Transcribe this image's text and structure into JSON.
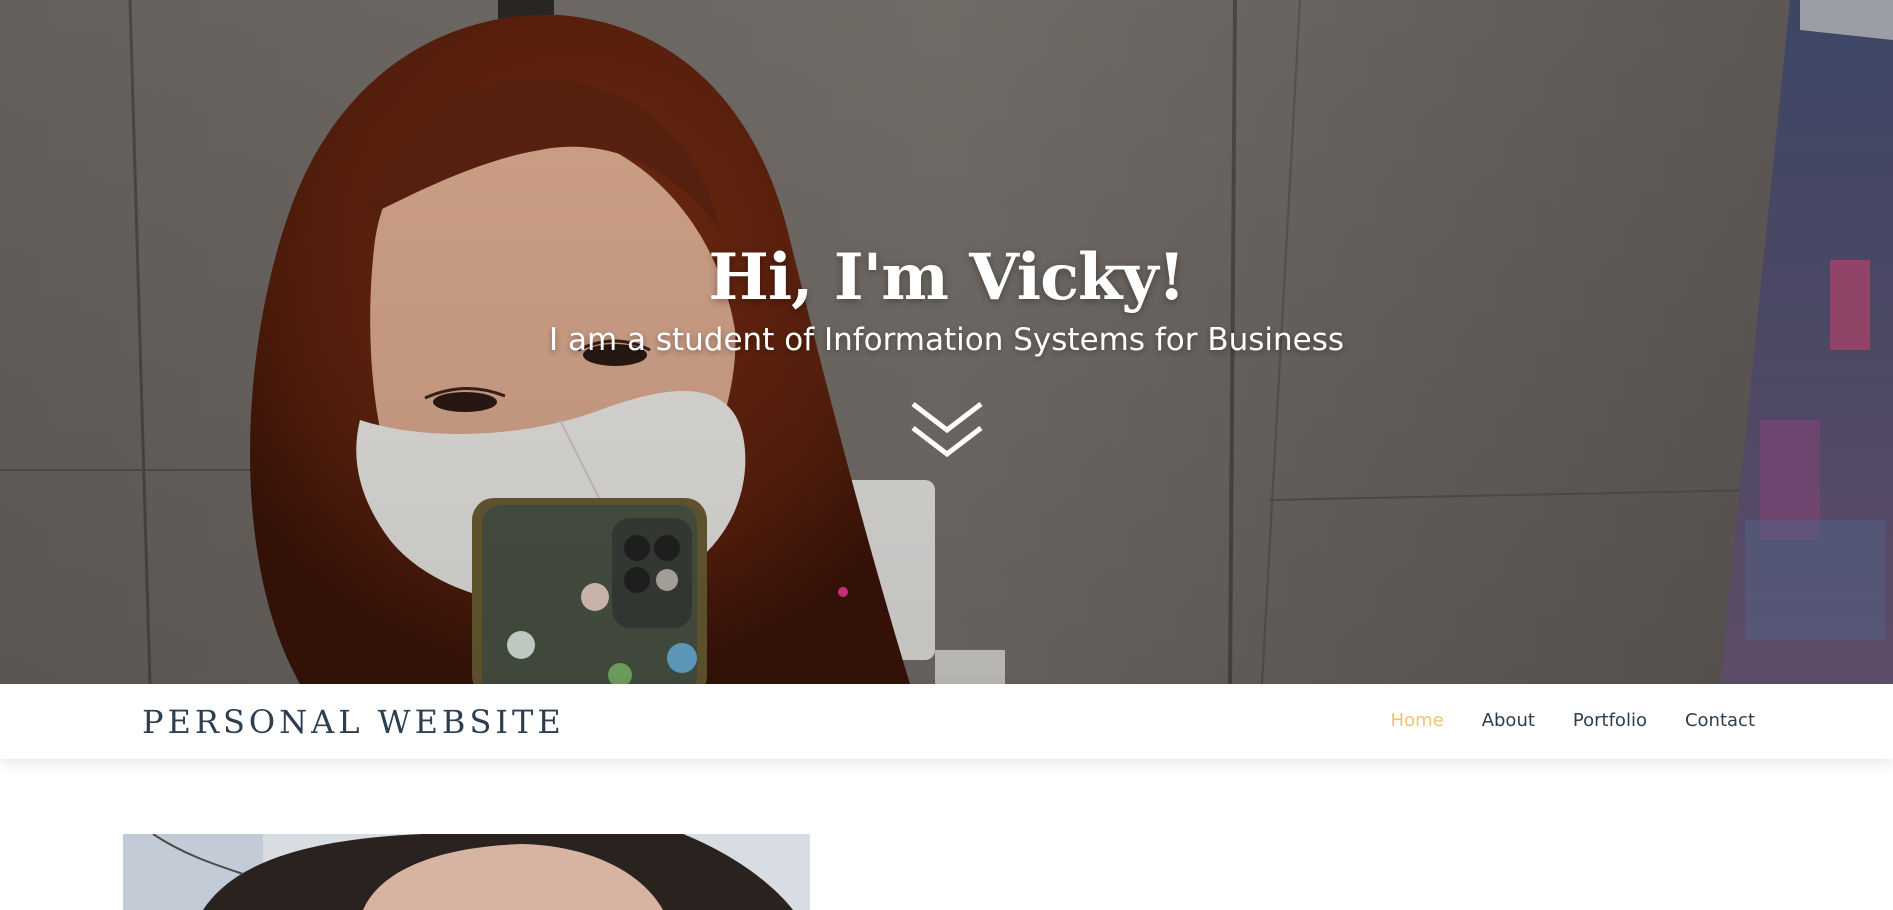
{
  "hero": {
    "title": "Hi, I'm Vicky!",
    "subtitle": "I am a student of Information Systems for Business",
    "scroll_icon": "double-chevron-down-icon",
    "photo": "hero-selfie-photo"
  },
  "navbar": {
    "brand": "PERSONAL WEBSITE",
    "links": [
      {
        "label": "Home",
        "active": true
      },
      {
        "label": "About",
        "active": false
      },
      {
        "label": "Portfolio",
        "active": false
      },
      {
        "label": "Contact",
        "active": false
      }
    ]
  },
  "about": {
    "photo": "profile-photo"
  },
  "colors": {
    "nav_text": "#2c3e50",
    "nav_active": "#f4c36b",
    "hero_text": "#ffffff"
  }
}
